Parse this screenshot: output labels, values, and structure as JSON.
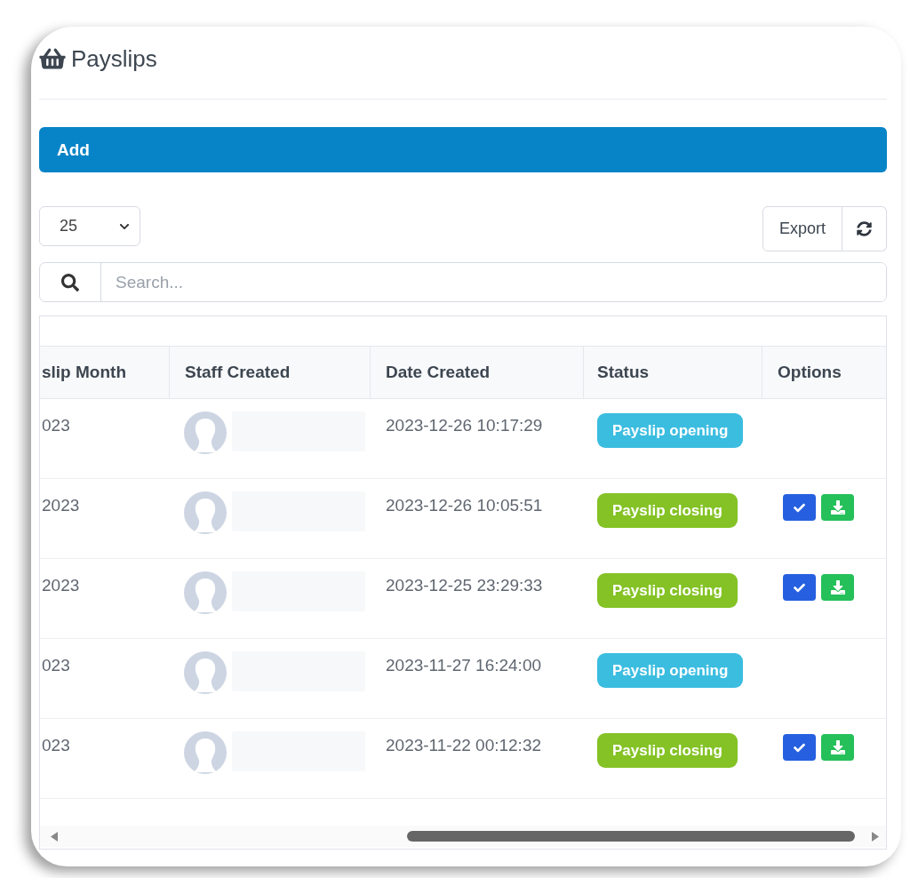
{
  "page": {
    "title": "Payslips"
  },
  "add_button": {
    "label": "Add"
  },
  "page_length": {
    "value": "25"
  },
  "export_button": {
    "label": "Export"
  },
  "search": {
    "placeholder": "Search..."
  },
  "table": {
    "columns": [
      "slip Month",
      "Staff Created",
      "Date Created",
      "Status",
      "Options"
    ],
    "rows": [
      {
        "month": "023",
        "date_created": "2023-12-26 10:17:29",
        "status": {
          "label": "Payslip opening",
          "color": "#3bbde0"
        }
      },
      {
        "month": "2023",
        "date_created": "2023-12-26 10:05:51",
        "status": {
          "label": "Payslip closing",
          "color": "#84c225"
        },
        "options": [
          {
            "kind": "check"
          },
          {
            "kind": "download"
          }
        ]
      },
      {
        "month": "2023",
        "date_created": "2023-12-25 23:29:33",
        "status": {
          "label": "Payslip closing",
          "color": "#84c225"
        },
        "options": [
          {
            "kind": "check"
          },
          {
            "kind": "download"
          }
        ]
      },
      {
        "month": "023",
        "date_created": "2023-11-27 16:24:00",
        "status": {
          "label": "Payslip opening",
          "color": "#3bbde0"
        }
      },
      {
        "month": "023",
        "date_created": "2023-11-22 00:12:32",
        "status": {
          "label": "Payslip closing",
          "color": "#84c225"
        },
        "options": [
          {
            "kind": "check"
          },
          {
            "kind": "download"
          }
        ]
      }
    ]
  }
}
